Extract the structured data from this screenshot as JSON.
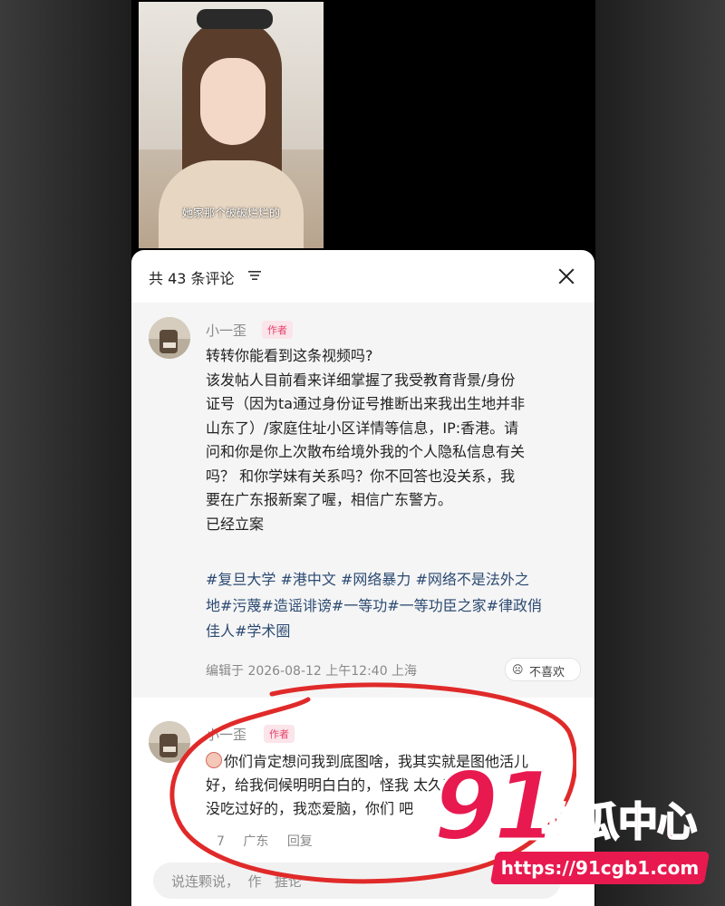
{
  "video": {
    "caption": "她家那个破破烂烂的"
  },
  "comments_header": {
    "title": "共 43 条评论 ",
    "filter_icon": "filter-lines-icon",
    "close_icon": "close-icon"
  },
  "comment1": {
    "username": "小一歪",
    "badge": "作者",
    "lines": [
      "转转你能看到这条视频吗?",
      "该发帖人目前看来详细掌握了我受教育背景/身份",
      "证号（因为ta通过身份证号推断出来我出生地并非",
      "山东了）/家庭住址小区详情等信息，IP:香港。请",
      "问和你是你上次散布给境外我的个人隐私信息有关",
      "吗？  和你学妹有关系吗？你不回答也没关系，我",
      "要在广东报新案了喔，相信广东警方。",
      "已经立案"
    ],
    "tags": [
      "#复旦大学 #港中文 #网络暴力 #网络不是法外之",
      "地#污蔑#造谣诽谤#一等功#一等功臣之家#律政俏",
      "佳人#学术圈"
    ],
    "meta": "编辑于  2026-08-12 上午12:40 上海",
    "dislike_label": "不喜欢",
    "dislike_icon": "sad-face-icon"
  },
  "comment2": {
    "username": "小一歪",
    "badge": "作者",
    "lines": [
      "你们肯定想问我到底图啥，我其实就是图他活儿",
      "好，给我伺候明明白白的，怪我        太久了",
      "没吃过好的，我恋爱脑，你们        吧"
    ],
    "meta_time": "7 ",
    "meta_location": "广东",
    "reply_label": "回复"
  },
  "input": {
    "placeholder": "说连颗说，  作   捱论"
  },
  "watermark": {
    "number": "91",
    "text": "吃瓜中心",
    "url": "https://91cgb1.com"
  },
  "colors": {
    "accent": "#e8194f",
    "tag_blue": "#2c4a72",
    "badge_pink": "#e5436b"
  }
}
